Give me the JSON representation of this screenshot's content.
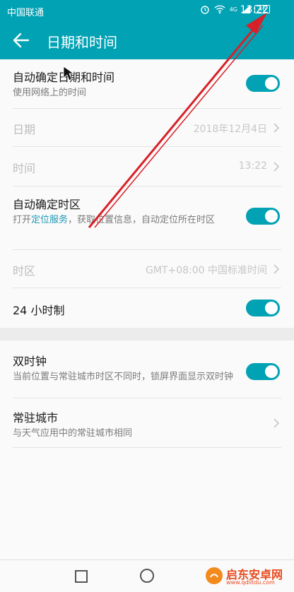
{
  "statusbar": {
    "carrier": "中国联通",
    "network": "46",
    "signal_label": "4G",
    "time": "13:22"
  },
  "header": {
    "title": "日期和时间",
    "back_icon": "arrow-left-icon"
  },
  "settings": {
    "auto_time": {
      "label": "自动确定日期和时间",
      "desc": "使用网络上的时间",
      "enabled": true
    },
    "date": {
      "label": "日期",
      "value": "2018年12月4日"
    },
    "time": {
      "label": "时间",
      "value": "13:22"
    },
    "auto_zone": {
      "label": "自动确定时区",
      "desc_before": "打开",
      "desc_link": "定位服务",
      "desc_after": "，获取位置信息，自动定位所在时区",
      "enabled": true
    },
    "zone": {
      "label": "时区",
      "value": "GMT+08:00 中国标准时间"
    },
    "hour24": {
      "label": "24 小时制",
      "enabled": true
    },
    "dual_clock": {
      "label": "双时钟",
      "desc": "当前位置与常驻城市时区不同时，锁屏界面显示双时钟",
      "enabled": true
    },
    "home_city": {
      "label": "常驻城市",
      "desc": "与天气应用中的常驻城市相同"
    }
  },
  "navbar": {
    "recent_icon": "square-icon",
    "home_icon": "circle-icon"
  },
  "watermark": {
    "name": "启东安卓网",
    "url": "www.qdlitdu.com"
  },
  "colors": {
    "accent": "#00a2b4",
    "link": "#1f97b6",
    "annotation": "#d82028"
  }
}
